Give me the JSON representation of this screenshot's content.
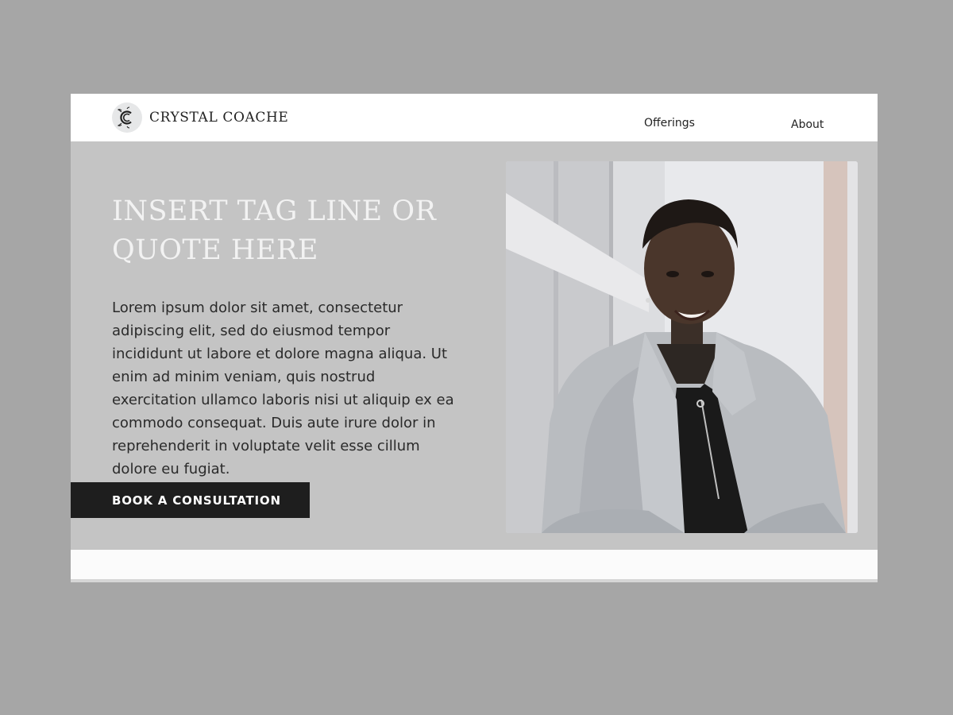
{
  "header": {
    "brand_name": "CRYSTAL COACHE",
    "nav": [
      {
        "label": "Offerings"
      },
      {
        "label": "About"
      }
    ]
  },
  "hero": {
    "tagline": "INSERT TAG LINE OR QUOTE HERE",
    "body": "Lorem ipsum dolor sit amet, consectetur adipiscing elit, sed do eiusmod tempor incididunt ut labore et dolore magna aliqua. Ut enim ad minim veniam, quis nostrud exercitation ullamco laboris nisi ut aliquip ex ea commodo consequat. Duis aute irure dolor in reprehenderit in voluptate velit esse cillum dolore eu fugiat.",
    "cta_label": "BOOK A CONSULTATION"
  },
  "colors": {
    "page_background": "#a6a6a6",
    "hero_background": "#c4c4c4",
    "header_background": "#ffffff",
    "cta_background": "#1e1e1e",
    "tagline_color": "#f2f2f2"
  },
  "icons": {
    "logo": "c-monogram-logo-icon"
  }
}
